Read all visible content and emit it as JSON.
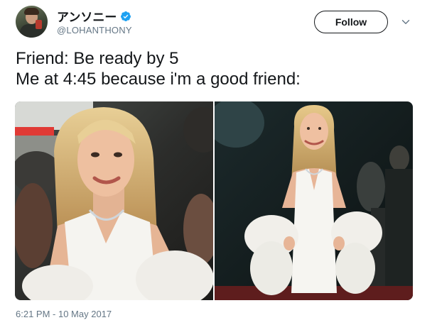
{
  "author": {
    "display_name": "アンソニー",
    "handle": "@LOHANTHONY",
    "verified": true,
    "verified_color": "#1da1f2"
  },
  "follow_button": {
    "label": "Follow"
  },
  "menu": {
    "icon": "chevron-down-icon"
  },
  "tweet": {
    "lines": [
      "Friend: Be ready by 5",
      "Me at 4:45 because i'm a good friend:"
    ]
  },
  "media": {
    "photos": [
      {
        "subject": "woman-in-white-dress-closeup"
      },
      {
        "subject": "woman-in-white-dress-fur-stole"
      }
    ]
  },
  "timestamp": "6:21 PM - 10 May 2017",
  "colors": {
    "text": "#14171a",
    "muted": "#657786",
    "accent": "#1da1f2"
  }
}
